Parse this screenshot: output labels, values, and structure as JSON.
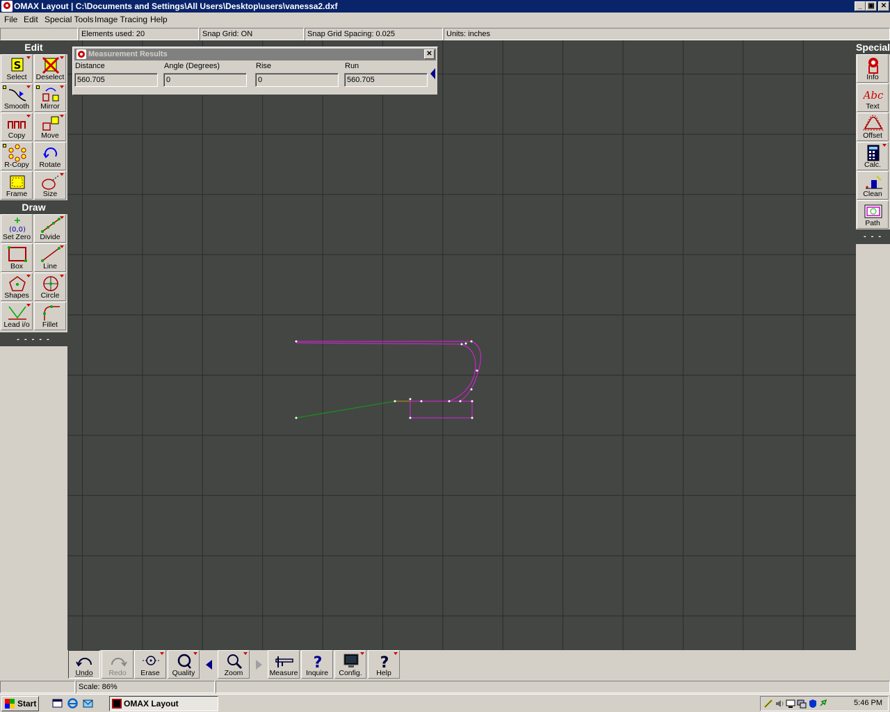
{
  "window": {
    "title": "OMAX Layout | C:\\Documents and Settings\\All Users\\Desktop\\users\\vanessa2.dxf",
    "minimize": "_",
    "maximize": "▣",
    "close": "✕"
  },
  "menu": [
    "File",
    "Edit",
    "Special Tools",
    "Image Tracing",
    "Help"
  ],
  "status_top": {
    "elements": "Elements used: 20",
    "snap_grid": "Snap Grid: ON",
    "snap_spacing": "Snap Grid Spacing: 0.025",
    "units": "Units: inches"
  },
  "left_panel": {
    "edit_header": "Edit",
    "edit_tools": [
      "Select",
      "Deselect",
      "Smooth",
      "Mirror",
      "Copy",
      "Move",
      "R-Copy",
      "Rotate",
      "Frame",
      "Size"
    ],
    "draw_header": "Draw",
    "draw_tools": [
      "Set Zero",
      "Divide",
      "Box",
      "Line",
      "Shapes",
      "Circle",
      "Lead i/o",
      "Fillet"
    ],
    "setzero_glyph": "(0,0)",
    "dashes": "- - - - -"
  },
  "right_panel": {
    "header": "Special",
    "tools": [
      "Info",
      "Text",
      "Offset",
      "Calc.",
      "Clean",
      "Path"
    ],
    "text_glyph": "Abc",
    "dashes": "- - -"
  },
  "measurement": {
    "title": "Measurement Results",
    "close": "✕",
    "fields": [
      {
        "label": "Distance",
        "value": "560.705"
      },
      {
        "label": "Angle (Degrees)",
        "value": "0"
      },
      {
        "label": "Rise",
        "value": "0"
      },
      {
        "label": "Run",
        "value": "560.705"
      }
    ]
  },
  "bottom_tools": [
    "Undo",
    "Redo",
    "Erase",
    "Quality",
    "Zoom",
    "Measure",
    "Inquire",
    "Config.",
    "Help"
  ],
  "inquire_glyph": "?",
  "help_glyph": "?",
  "status_bottom": {
    "scale": "Scale: 86%"
  },
  "taskbar": {
    "start": "Start",
    "task": "OMAX Layout",
    "clock": "5:46 PM"
  },
  "colors": {
    "canvas": "#444644",
    "part_path": "#e020e0",
    "lead_in": "#10a010",
    "lead_segment": "#c09020",
    "title_active": "#0a246a"
  }
}
